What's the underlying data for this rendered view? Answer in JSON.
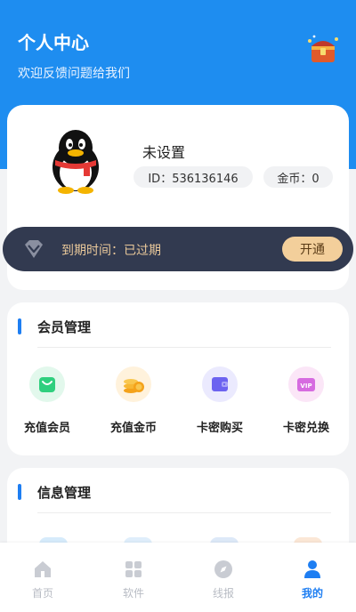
{
  "header": {
    "title": "个人中心",
    "subtitle": "欢迎反馈问题给我们",
    "icon": "treasure-chest-icon"
  },
  "profile": {
    "avatar_icon": "qq-penguin-avatar",
    "username": "未设置",
    "id_text": "ID：536136146",
    "coin_text": "金币：0"
  },
  "vip": {
    "icon": "diamond-icon",
    "expire_text": "到期时间：已过期",
    "open_label": "开通"
  },
  "member_section": {
    "title": "会员管理",
    "items": [
      {
        "label": "充值会员",
        "icon": "shopping-bag-icon"
      },
      {
        "label": "充值金币",
        "icon": "coin-stack-icon"
      },
      {
        "label": "卡密购买",
        "icon": "wallet-icon"
      },
      {
        "label": "卡密兑换",
        "icon": "vip-card-icon"
      }
    ]
  },
  "info_section": {
    "title": "信息管理"
  },
  "bottom_nav": {
    "items": [
      {
        "label": "首页",
        "icon": "home-icon",
        "active": false
      },
      {
        "label": "软件",
        "icon": "apps-grid-icon",
        "active": false
      },
      {
        "label": "线报",
        "icon": "compass-icon",
        "active": false
      },
      {
        "label": "我的",
        "icon": "user-icon",
        "active": true
      }
    ]
  },
  "colors": {
    "primary": "#1e8df0",
    "vip_bar": "#323a50",
    "vip_gold": "#e9c89a",
    "open_button": "#f3cf9b",
    "active_nav": "#1e7ef2",
    "inactive_nav": "#b8bcc4"
  }
}
